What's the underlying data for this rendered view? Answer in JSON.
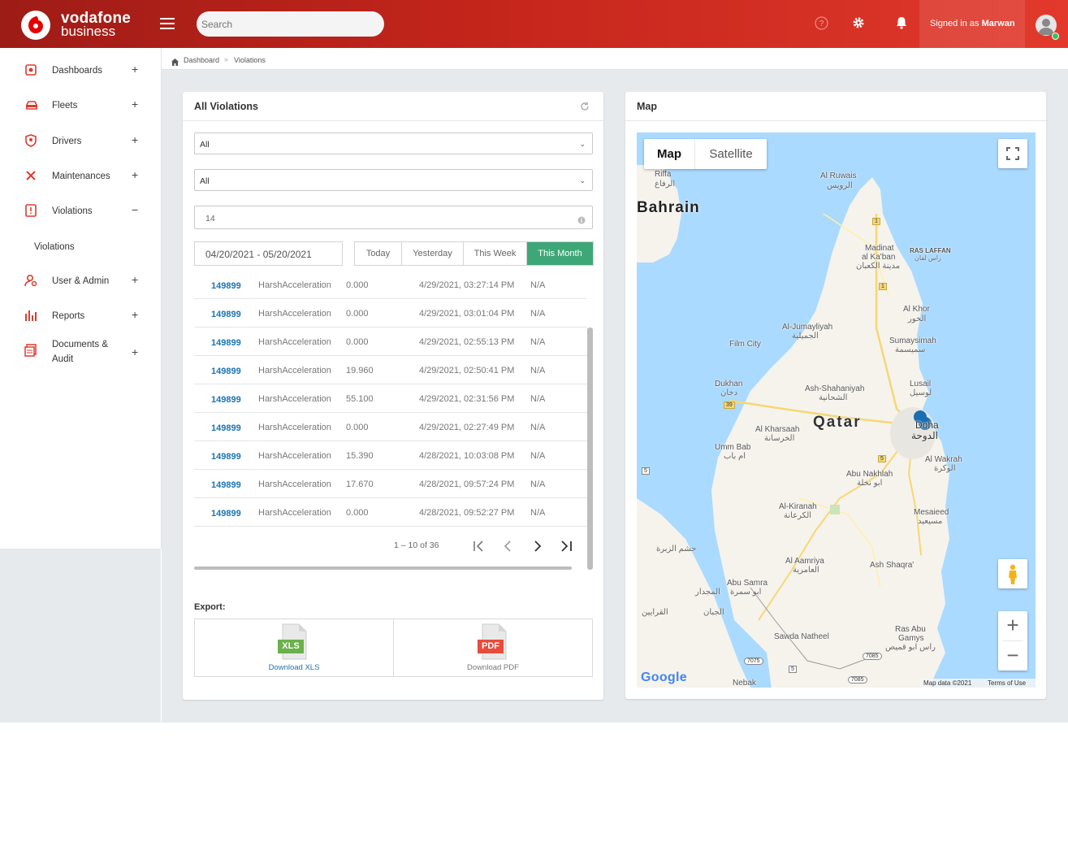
{
  "brand": {
    "name": "vodafone",
    "sub": "business"
  },
  "header": {
    "search_placeholder": "Search",
    "signed_prefix": "Signed in as",
    "user": "Marwan"
  },
  "sidebar": {
    "items": [
      {
        "label": "Dashboards",
        "toggle": "+"
      },
      {
        "label": "Fleets",
        "toggle": "+"
      },
      {
        "label": "Drivers",
        "toggle": "+"
      },
      {
        "label": "Maintenances",
        "toggle": "+"
      },
      {
        "label": "Violations",
        "toggle": "−"
      },
      {
        "label": "User & Admin",
        "toggle": "+"
      },
      {
        "label": "Reports",
        "toggle": "+"
      },
      {
        "label": "Documents &",
        "label2": "Audit",
        "toggle": "+"
      }
    ],
    "sub_item": "Violations"
  },
  "breadcrumb": {
    "home": "Dashboard",
    "sep": "»",
    "current": "Violations"
  },
  "violations_panel": {
    "title": "All Violations",
    "filter1": "All",
    "filter2": "All",
    "filter3": "14",
    "date_range": "04/20/2021 - 05/20/2021",
    "ranges": [
      "Today",
      "Yesterday",
      "This Week",
      "This Month"
    ],
    "rows": [
      {
        "id": "149899",
        "type": "HarshAcceleration",
        "value": "0.000",
        "datetime": "4/29/2021, 03:27:14 PM",
        "na": "N/A"
      },
      {
        "id": "149899",
        "type": "HarshAcceleration",
        "value": "0.000",
        "datetime": "4/29/2021, 03:01:04 PM",
        "na": "N/A"
      },
      {
        "id": "149899",
        "type": "HarshAcceleration",
        "value": "0.000",
        "datetime": "4/29/2021, 02:55:13 PM",
        "na": "N/A"
      },
      {
        "id": "149899",
        "type": "HarshAcceleration",
        "value": "19.960",
        "datetime": "4/29/2021, 02:50:41 PM",
        "na": "N/A"
      },
      {
        "id": "149899",
        "type": "HarshAcceleration",
        "value": "55.100",
        "datetime": "4/29/2021, 02:31:56 PM",
        "na": "N/A"
      },
      {
        "id": "149899",
        "type": "HarshAcceleration",
        "value": "0.000",
        "datetime": "4/29/2021, 02:27:49 PM",
        "na": "N/A"
      },
      {
        "id": "149899",
        "type": "HarshAcceleration",
        "value": "15.390",
        "datetime": "4/28/2021, 10:03:08 PM",
        "na": "N/A"
      },
      {
        "id": "149899",
        "type": "HarshAcceleration",
        "value": "17.670",
        "datetime": "4/28/2021, 09:57:24 PM",
        "na": "N/A"
      },
      {
        "id": "149899",
        "type": "HarshAcceleration",
        "value": "0.000",
        "datetime": "4/28/2021, 09:52:27 PM",
        "na": "N/A"
      }
    ],
    "pager": "1 – 10 of 36",
    "export_label": "Export:",
    "xls_badge": "XLS",
    "pdf_badge": "PDF",
    "download_xls": "Download XLS",
    "download_pdf": "Download PDF"
  },
  "map_panel": {
    "title": "Map",
    "tab_map": "Map",
    "tab_satellite": "Satellite",
    "country": "Qatar",
    "places": [
      "Bahrain",
      "Riffa",
      "الرفاع",
      "Al Ruwais",
      "الرويس",
      "Madinat",
      "al Ka'ban",
      "مدينة الكعبان",
      "RAS LAFFAN",
      "راس لفان",
      "Al Khor",
      "الخور",
      "Al-Jumayliyah",
      "الجميلية",
      "Film City",
      "Sumaysimah",
      "سميسمة",
      "Dukhan",
      "دخان",
      "Ash-Shahaniyah",
      "الشحانية",
      "Lusail",
      "لوسيل",
      "Al Kharsaah",
      "الخرسانة",
      "Doha",
      "الدوحة",
      "Umm Bab",
      "ام باب",
      "Abu Nakhlah",
      "ابو نخلة",
      "Al Wakrah",
      "الوكرة",
      "Al-Kiranah",
      "الكرعانة",
      "Mesaieed",
      "مسيعيد",
      "حشم الزبرة",
      "Al Aamriya",
      "العامرية",
      "Ash Shaqra'",
      "Abu Samra",
      "ابو سمرة",
      "المجدار",
      "القرايين",
      "الجبان",
      "Sawda Natheel",
      "Ras Abu",
      "Gamys",
      "راس ابو قميص",
      "Nebak"
    ],
    "roads": [
      "1",
      "1",
      "39",
      "5",
      "5",
      "5",
      "7075",
      "7085",
      "7085"
    ],
    "footer_brand": "Google",
    "footer_data": "Map data ©2021",
    "footer_terms": "Terms of Use",
    "zoom_in": "+",
    "zoom_out": "−"
  },
  "colors": {
    "brand_red": "#e03a2f",
    "link_blue": "#1b73b3",
    "active_green": "#3ea777",
    "map_water": "#aadaff",
    "map_land": "#f5f3ec"
  }
}
